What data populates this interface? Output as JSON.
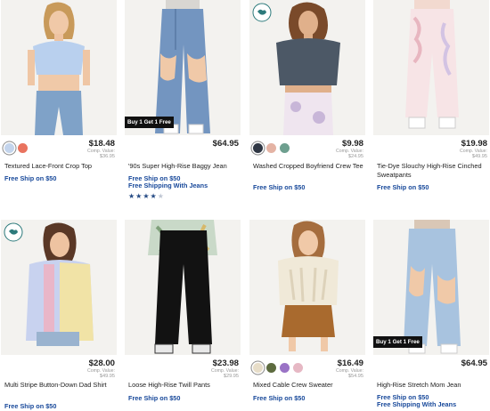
{
  "products": [
    {
      "name": "Textured Lace-Front Crop Top",
      "price": "$18.48",
      "comp_label": "Comp. Value:",
      "comp_value": "$36.95",
      "swatches": [
        "#c3d4ec",
        "#e9735f"
      ],
      "shipping": [
        "Free Ship on $50"
      ],
      "badge": ""
    },
    {
      "name": "'90s Super High-Rise Baggy Jean",
      "price": "$64.95",
      "comp_label": "",
      "comp_value": "",
      "swatches": [],
      "shipping": [
        "Free Ship on $50",
        "Free Shipping With Jeans"
      ],
      "badge": "Buy 1 Get 1 Free",
      "rating": 4,
      "rating_max": 5
    },
    {
      "name": "Washed Cropped Boyfriend Crew Tee",
      "price": "$9.98",
      "comp_label": "Comp. Value:",
      "comp_value": "$24.95",
      "swatches": [
        "#2f3744",
        "#e4b3a4",
        "#6e9f8f"
      ],
      "shipping": [
        "Free Ship on $50"
      ],
      "badge": "",
      "earth_badge": "earth-tag-icon"
    },
    {
      "name": "Tie-Dye Slouchy High-Rise Cinched Sweatpants",
      "price": "$19.98",
      "comp_label": "Comp. Value:",
      "comp_value": "$49.95",
      "swatches": [],
      "shipping": [
        "Free Ship on $50"
      ],
      "badge": ""
    },
    {
      "name": "Multi Stripe Button-Down Dad Shirt",
      "price": "$28.00",
      "comp_label": "Comp. Value:",
      "comp_value": "$49.95",
      "swatches": [],
      "shipping": [
        "Free Ship on $50"
      ],
      "badge": "",
      "earth_badge": "earth-tag-icon"
    },
    {
      "name": "Loose High-Rise Twill Pants",
      "price": "$23.98",
      "comp_label": "Comp. Value:",
      "comp_value": "$29.95",
      "swatches": [],
      "shipping": [
        "Free Ship on $50"
      ],
      "badge": ""
    },
    {
      "name": "Mixed Cable Crew Sweater",
      "price": "$16.49",
      "comp_label": "Comp. Value:",
      "comp_value": "$54.95",
      "swatches": [
        "#e7ddc8",
        "#5d6b3f",
        "#9a73c6",
        "#e6b8c4"
      ],
      "shipping": [
        "Free Ship on $50"
      ],
      "badge": ""
    },
    {
      "name": "High-Rise Stretch Mom Jean",
      "price": "$64.95",
      "comp_label": "",
      "comp_value": "",
      "swatches": [],
      "shipping": [
        "Free Ship on $50",
        "Free Shipping With Jeans"
      ],
      "badge": "Buy 1 Get 1 Free"
    }
  ],
  "colors": {
    "shipping_text": "#17489a",
    "badge_bg": "#111111",
    "star_on": "#244a84"
  }
}
